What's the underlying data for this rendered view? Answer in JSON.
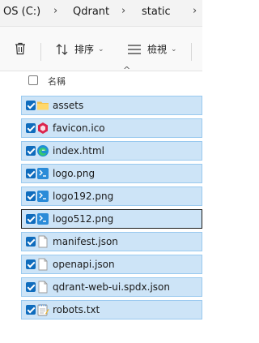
{
  "breadcrumb": {
    "items": [
      "OS (C:)",
      "Qdrant",
      "static"
    ]
  },
  "toolbar": {
    "sort_label": "排序",
    "view_label": "檢視"
  },
  "header": {
    "name_column": "名稱"
  },
  "files": [
    {
      "name": "assets",
      "icon": "folder-icon",
      "selected": true
    },
    {
      "name": "favicon.ico",
      "icon": "qdrant-icon",
      "selected": true
    },
    {
      "name": "index.html",
      "icon": "edge-icon",
      "selected": true
    },
    {
      "name": "logo.png",
      "icon": "image-icon",
      "selected": true
    },
    {
      "name": "logo192.png",
      "icon": "image-icon",
      "selected": true
    },
    {
      "name": "logo512.png",
      "icon": "image-icon",
      "selected": true
    },
    {
      "name": "manifest.json",
      "icon": "file-icon",
      "selected": true
    },
    {
      "name": "openapi.json",
      "icon": "file-icon",
      "selected": true
    },
    {
      "name": "qdrant-web-ui.spdx.json",
      "icon": "file-icon",
      "selected": true
    },
    {
      "name": "robots.txt",
      "icon": "notepad-icon",
      "selected": true
    }
  ],
  "colors": {
    "selection_bg": "#cde4f7",
    "accent": "#0f6cbd"
  }
}
